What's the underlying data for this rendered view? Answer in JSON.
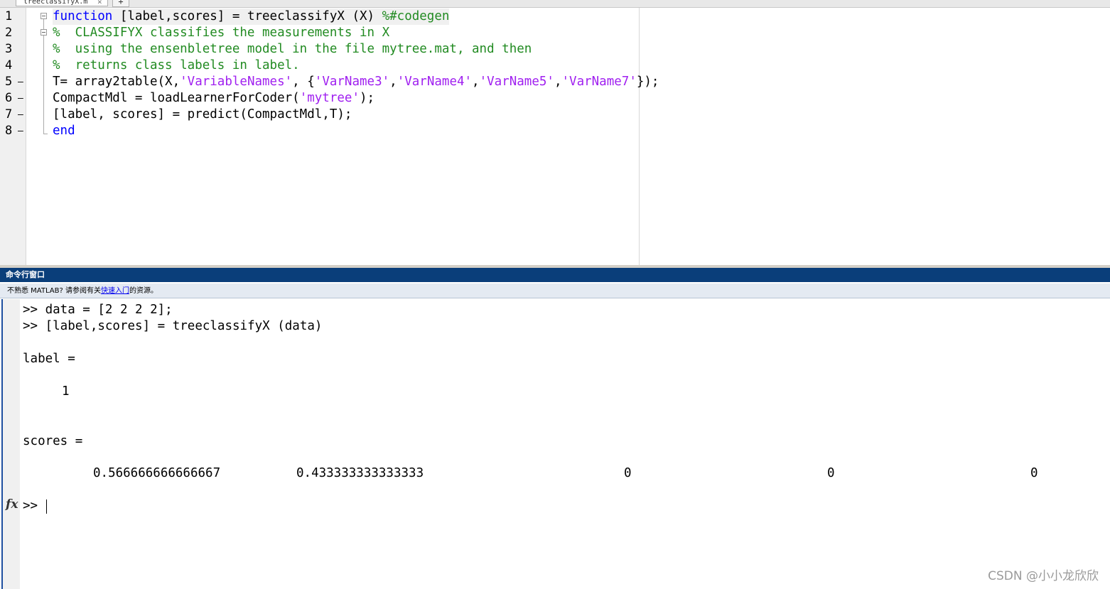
{
  "editor": {
    "tab_label": "treeclassifyX.m",
    "tab_close": "×",
    "tab_add": "+",
    "line_numbers": [
      "1",
      "2",
      "3",
      "4",
      "5",
      "6",
      "7",
      "8"
    ],
    "lines": {
      "l1": {
        "kw": "function",
        "text": " [label,scores] = treeclassifyX (X) ",
        "comment": "%#codegen"
      },
      "l2": {
        "comment": "%  CLASSIFYX classifies the measurements in X"
      },
      "l3": {
        "comment": "%  using the ensenbletree model in the file mytree.mat, and then"
      },
      "l4": {
        "comment": "%  returns class labels in label."
      },
      "l5": {
        "a": "T= array2table(X,",
        "s1": "'VariableNames'",
        "b": ", {",
        "s2": "'VarName3'",
        "c1": ",",
        "s3": "'VarName4'",
        "c2": ",",
        "s4": "'VarName5'",
        "c3": ",",
        "s5": "'VarName7'",
        "d": "});"
      },
      "l6": {
        "a": "CompactMdl = loadLearnerForCoder(",
        "s1": "'mytree'",
        "b": ");"
      },
      "l7": {
        "a": "[label, scores] = predict(CompactMdl,T);"
      },
      "l8": {
        "kw": "end"
      }
    }
  },
  "command_window": {
    "title": "命令行窗口",
    "info_prefix": "不熟悉 MATLAB? 请参阅有关",
    "info_link": "快速入门",
    "info_suffix": "的资源。",
    "lines": {
      "cmd1": ">> data = [2 2 2 2];",
      "cmd2": ">> [label,scores] = treeclassifyX (data)",
      "label_hdr": "label =",
      "label_val": "1",
      "scores_hdr": "scores =",
      "prompt": ">> "
    },
    "scores": [
      "0.566666666666667",
      "0.433333333333333",
      "0",
      "0",
      "0"
    ],
    "fx_label": "fx"
  },
  "watermark": "CSDN @小小龙欣欣"
}
